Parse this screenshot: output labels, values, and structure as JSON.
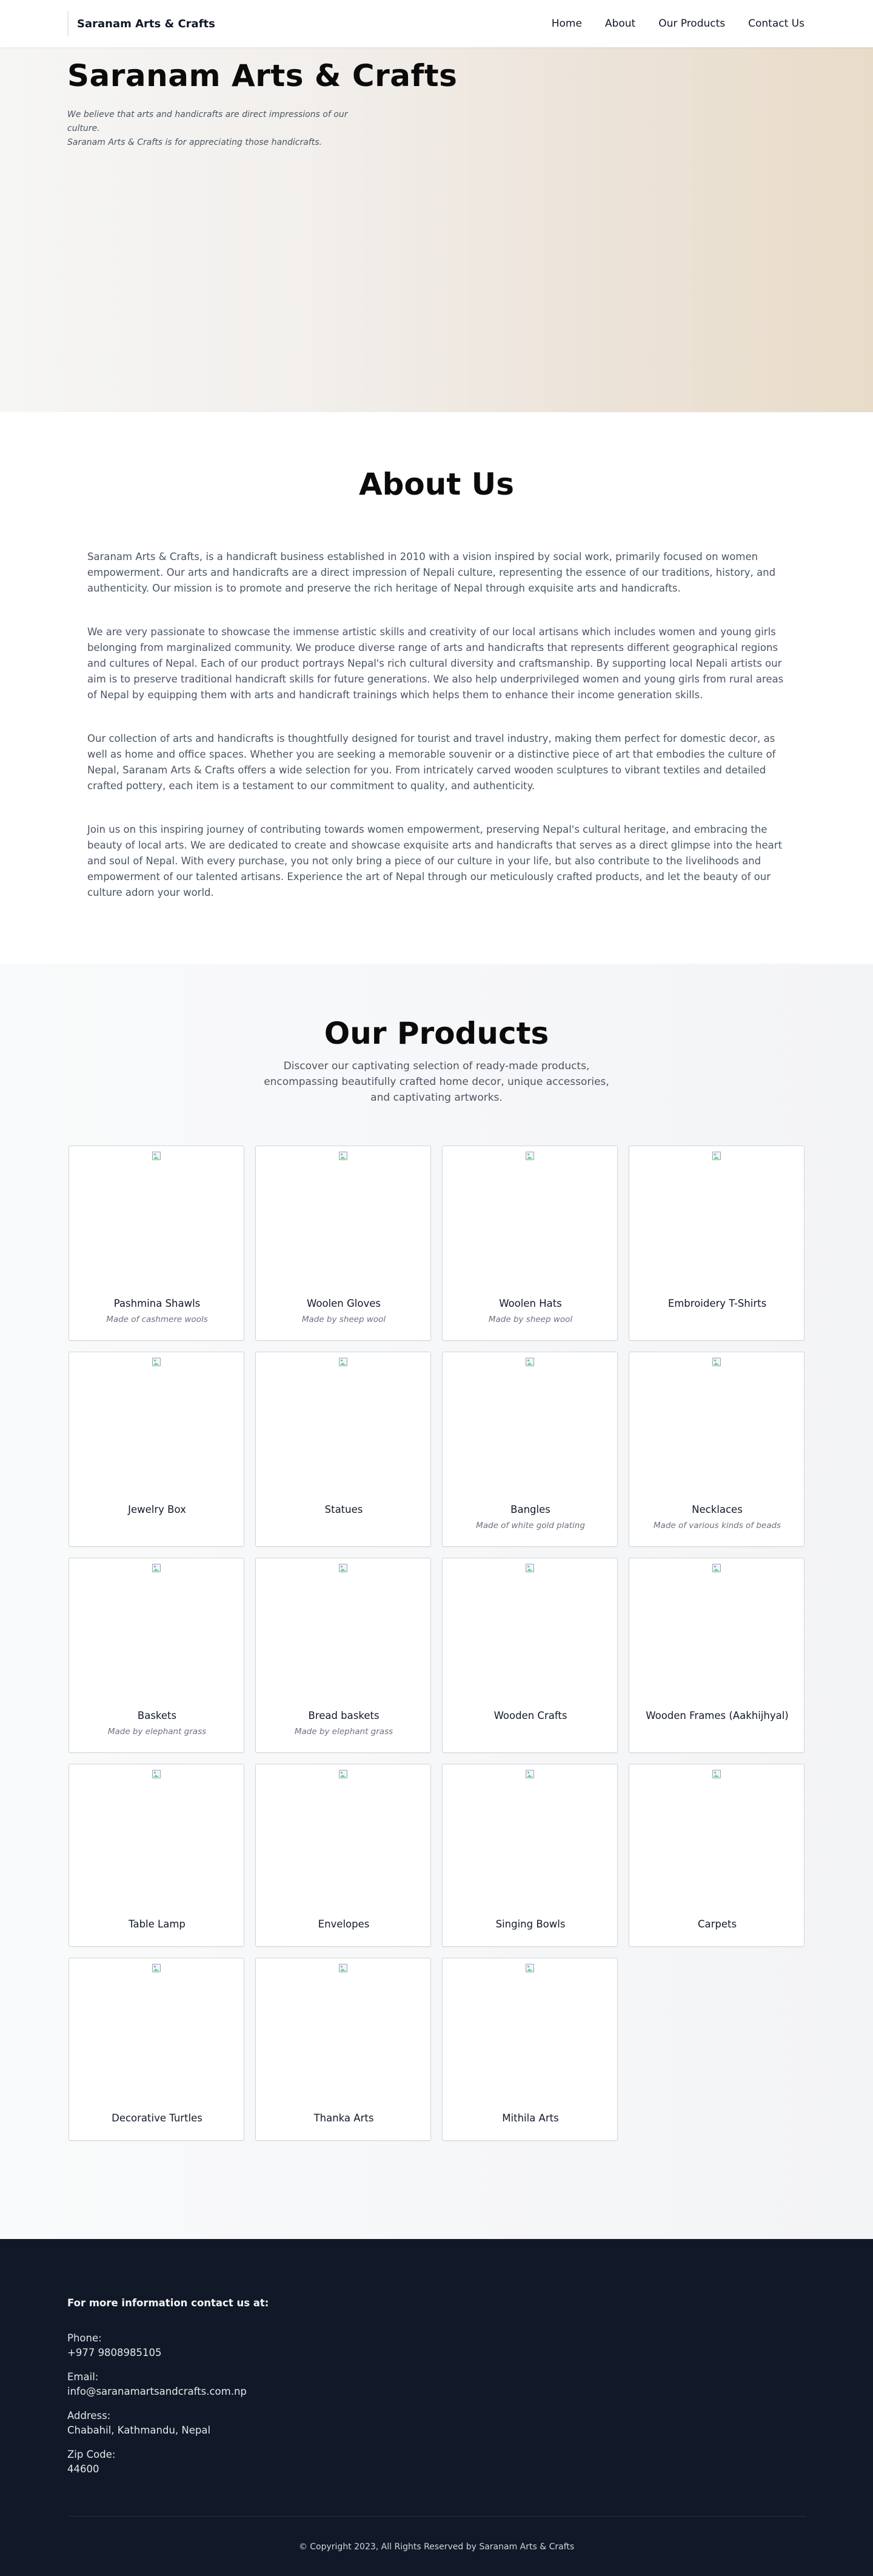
{
  "nav": {
    "brand": "Saranam Arts & Crafts",
    "links": [
      "Home",
      "About",
      "Our Products",
      "Contact Us"
    ]
  },
  "hero": {
    "title": "Saranam Arts & Crafts",
    "line1": "We believe that arts and handicrafts are direct impressions of our culture.",
    "line2": "Saranam Arts & Crafts is for appreciating those handicrafts."
  },
  "about": {
    "title": "About Us",
    "paragraphs": [
      "Saranam Arts & Crafts, is a handicraft business established in 2010 with a vision inspired by social work, primarily focused on women empowerment. Our arts and handicrafts are a direct impression of Nepali culture, representing the essence of our traditions, history, and authenticity. Our mission is to promote and preserve the rich heritage of Nepal through exquisite arts and handicrafts.",
      "We are very passionate to showcase the immense artistic skills and creativity of our local artisans which includes women and young girls belonging from marginalized community. We produce diverse range of arts and handicrafts that represents different geographical regions and cultures of Nepal. Each of our product portrays Nepal's rich cultural diversity and craftsmanship. By supporting local Nepali artists our aim is to preserve traditional handicraft skills for future generations. We also help underprivileged women and young girls from rural areas of Nepal by equipping them with arts and handicraft trainings which helps them to enhance their income generation skills.",
      "Our collection of arts and handicrafts is thoughtfully designed for tourist and travel industry, making them perfect for domestic decor, as well as home and office spaces. Whether you are seeking a memorable souvenir or a distinctive piece of art that embodies the culture of Nepal, Saranam Arts & Crafts offers a wide selection for you. From intricately carved wooden sculptures to vibrant textiles and detailed crafted pottery, each item is a testament to our commitment to quality, and authenticity.",
      "Join us on this inspiring journey of contributing towards women empowerment, preserving Nepal's cultural heritage, and embracing the beauty of local arts. We are dedicated to create and showcase exquisite arts and handicrafts that serves as a direct glimpse into the heart and soul of Nepal. With every purchase, you not only bring a piece of our culture in your life, but also contribute to the livelihoods and empowerment of our talented artisans. Experience the art of Nepal through our meticulously crafted products, and let the beauty of our culture adorn your world."
    ]
  },
  "products": {
    "title": "Our Products",
    "subtitle": "Discover our captivating selection of ready-made products, encompassing beautifully crafted home decor, unique accessories, and captivating artworks.",
    "image_icon": "broken-image-icon",
    "items": [
      {
        "name": "Pashmina Shawls",
        "desc": "Made of cashmere wools"
      },
      {
        "name": "Woolen Gloves",
        "desc": "Made by sheep wool"
      },
      {
        "name": "Woolen Hats",
        "desc": "Made by sheep wool"
      },
      {
        "name": "Embroidery T-Shirts",
        "desc": ""
      },
      {
        "name": "Jewelry Box",
        "desc": ""
      },
      {
        "name": "Statues",
        "desc": ""
      },
      {
        "name": "Bangles",
        "desc": "Made of white gold plating"
      },
      {
        "name": "Necklaces",
        "desc": "Made of various kinds of beads"
      },
      {
        "name": "Baskets",
        "desc": "Made by elephant grass"
      },
      {
        "name": "Bread baskets",
        "desc": "Made by elephant grass"
      },
      {
        "name": "Wooden Crafts",
        "desc": ""
      },
      {
        "name": "Wooden Frames (Aakhijhyal)",
        "desc": ""
      },
      {
        "name": "Table Lamp",
        "desc": ""
      },
      {
        "name": "Envelopes",
        "desc": ""
      },
      {
        "name": "Singing Bowls",
        "desc": ""
      },
      {
        "name": "Carpets",
        "desc": ""
      },
      {
        "name": "Decorative Turtles",
        "desc": ""
      },
      {
        "name": "Thanka Arts",
        "desc": ""
      },
      {
        "name": "Mithila Arts",
        "desc": ""
      }
    ]
  },
  "footer": {
    "heading": "For more information contact us at:",
    "phone_label": "Phone:",
    "phone": "+977 9808985105",
    "email_label": "Email:",
    "email": "info@saranamartsandcrafts.com.np",
    "address_label": "Address:",
    "address": "Chabahil, Kathmandu, Nepal",
    "zip_label": "Zip Code:",
    "zip": "44600",
    "copyright": "© Copyright 2023, All Rights Reserved by Saranam Arts & Crafts"
  },
  "colors": {
    "footer_bg": "#111827",
    "text_dark": "#111827",
    "text_muted": "#4b5563",
    "hero_gradient_end": "#e8dcc9"
  }
}
